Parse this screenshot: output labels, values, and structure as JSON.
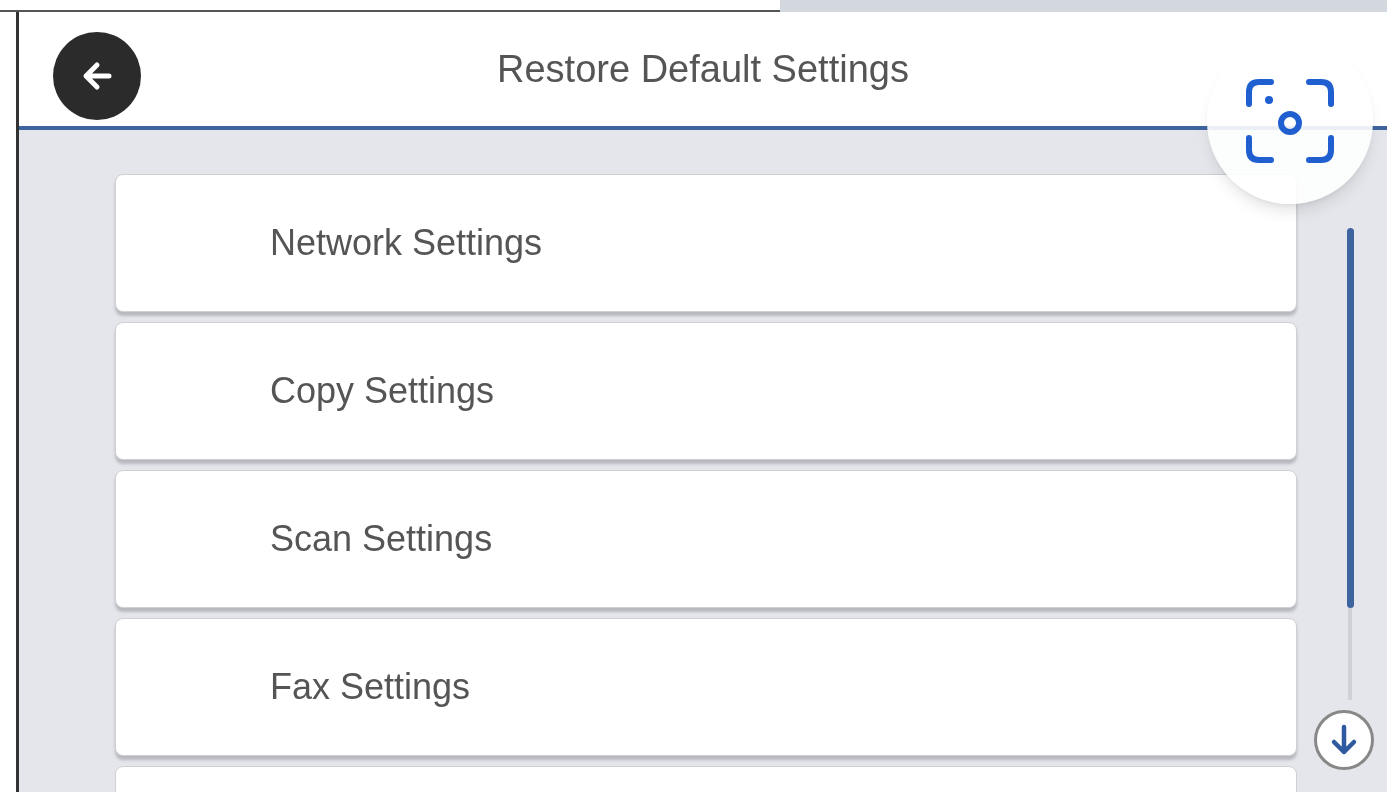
{
  "header": {
    "title": "Restore Default Settings"
  },
  "items": [
    {
      "label": "Network Settings"
    },
    {
      "label": "Copy Settings"
    },
    {
      "label": "Scan Settings"
    },
    {
      "label": "Fax Settings"
    }
  ]
}
